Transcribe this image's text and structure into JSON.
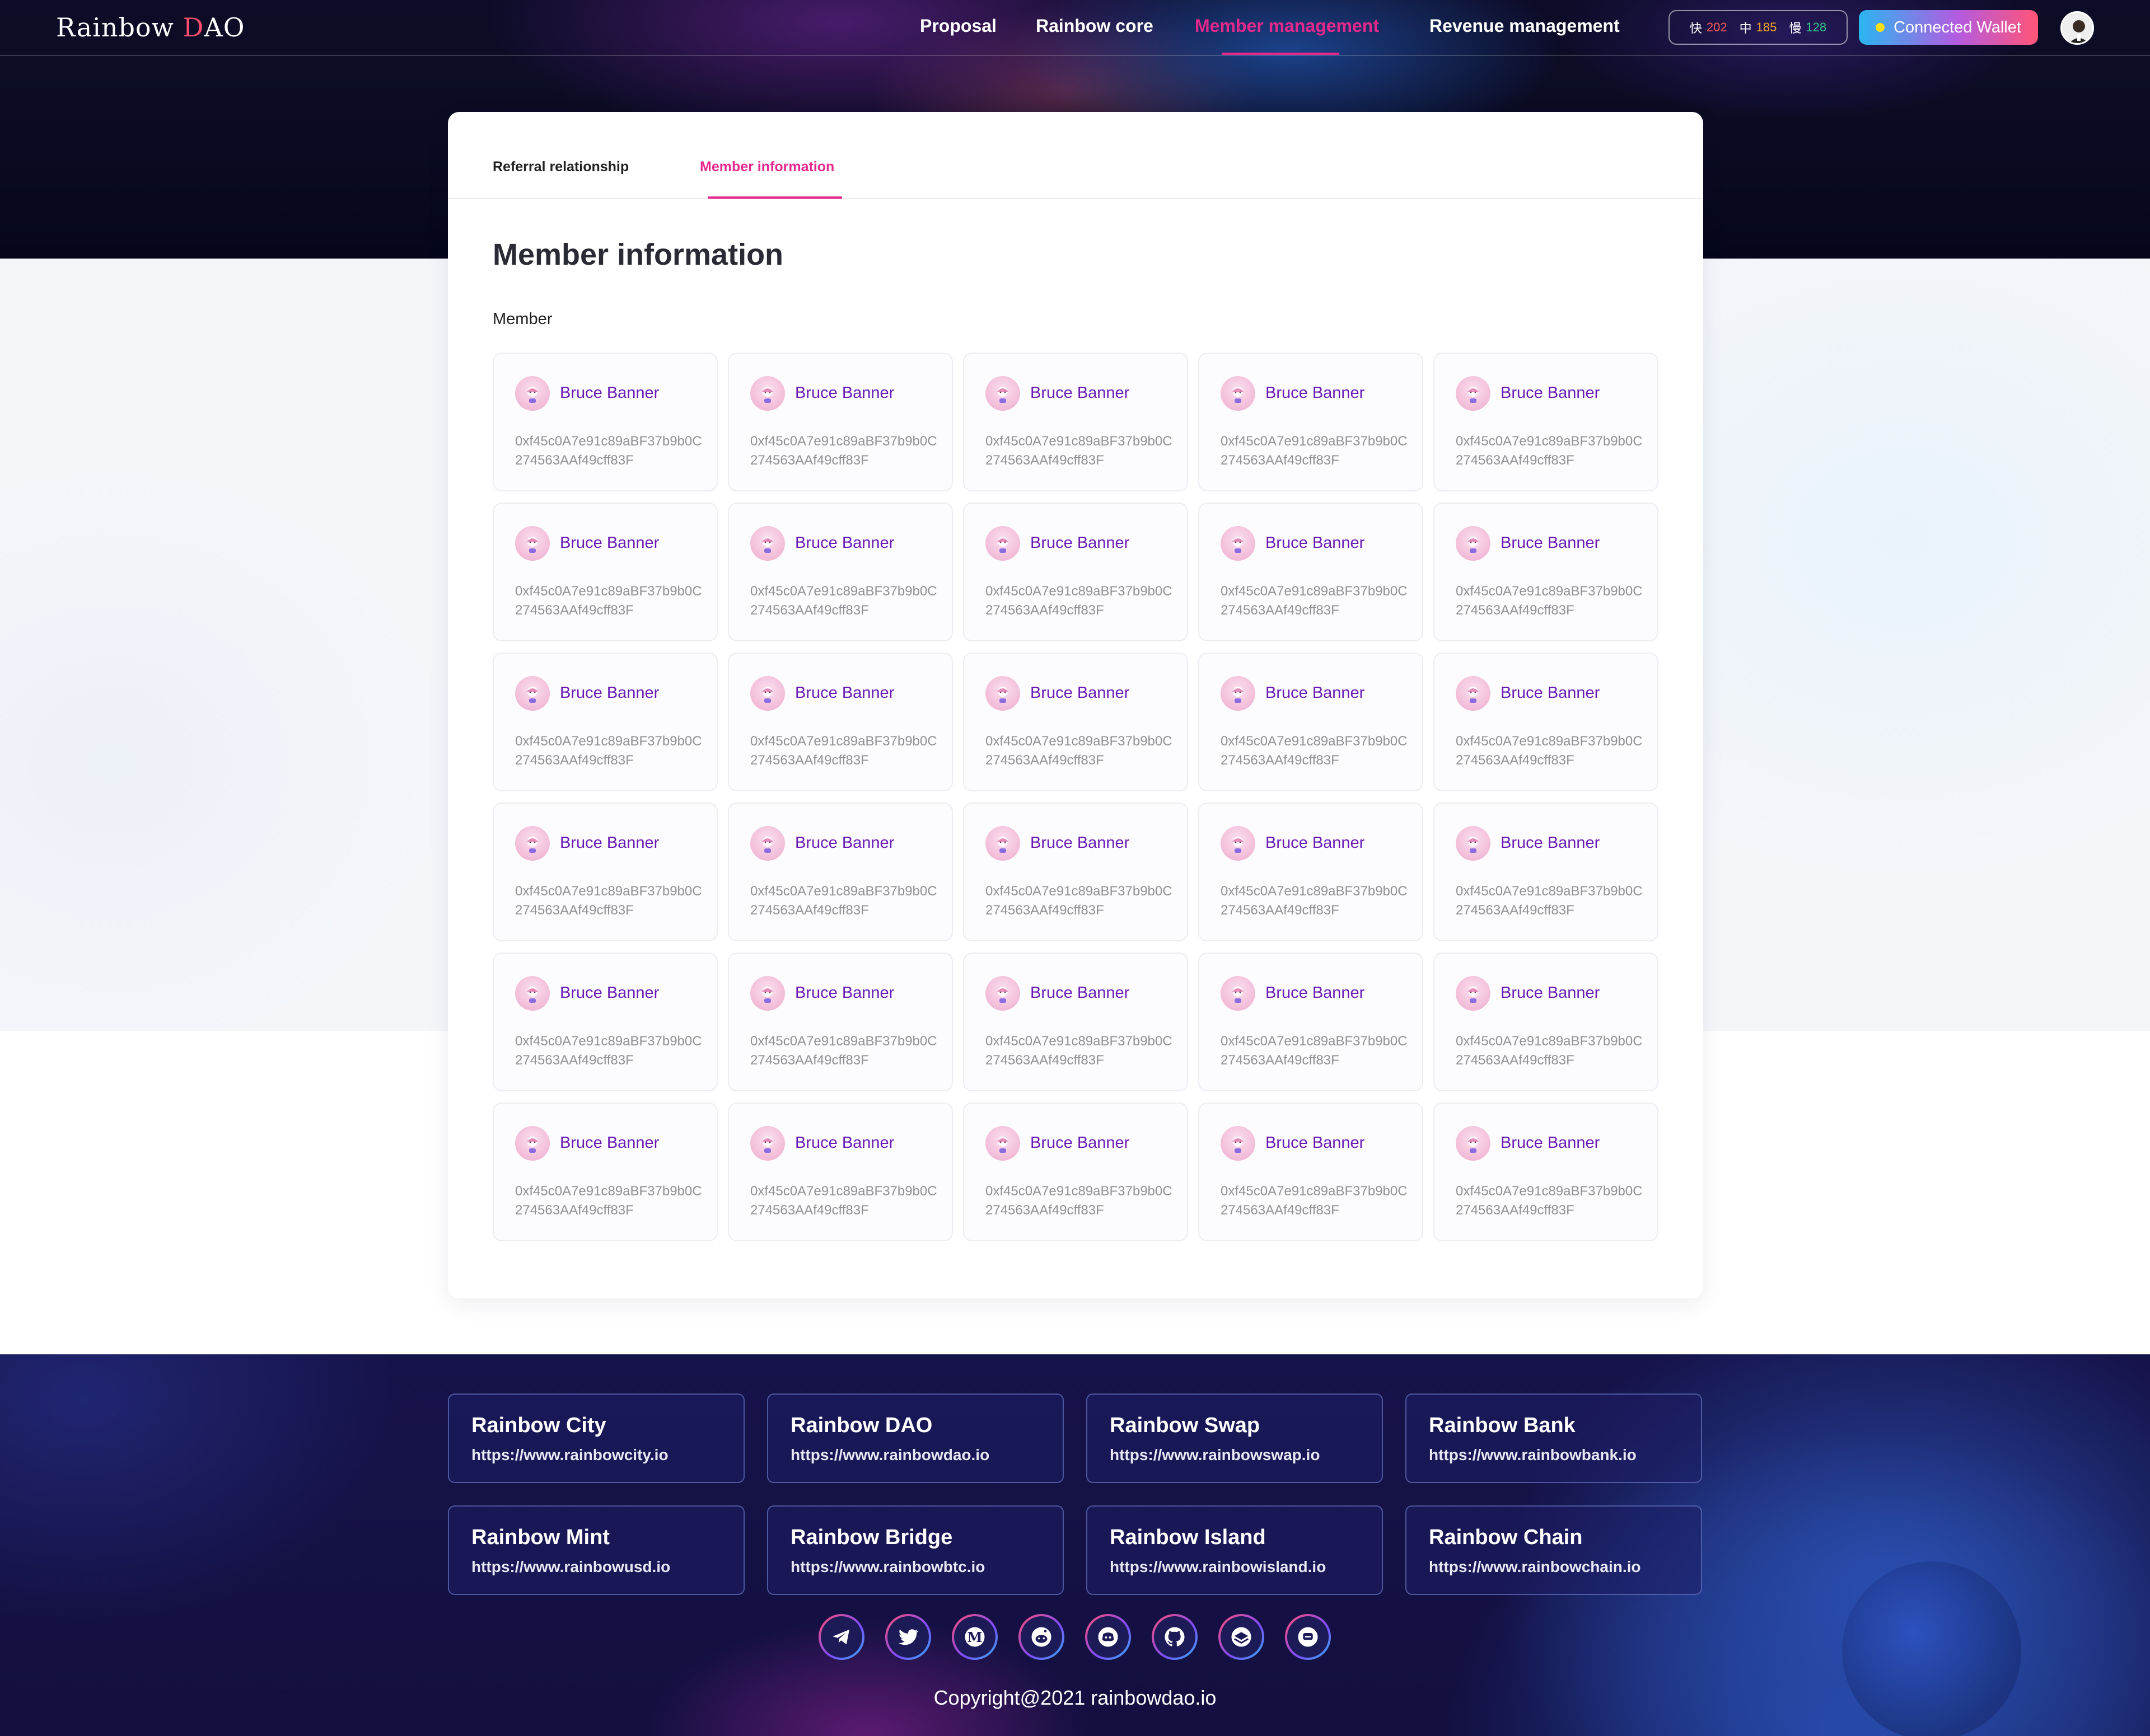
{
  "brand": {
    "logo_main": "Rainbow ",
    "logo_d": "D",
    "logo_rest": "AO"
  },
  "nav": {
    "links": [
      "Proposal",
      "Rainbow core",
      "Member management",
      "Revenue management"
    ],
    "active_index": 2,
    "gas": [
      {
        "label": "快",
        "value": "202"
      },
      {
        "label": "中",
        "value": "185"
      },
      {
        "label": "慢",
        "value": "128"
      }
    ],
    "wallet_label": "Connected Wallet"
  },
  "tabs": [
    "Referral relationship",
    "Member information"
  ],
  "active_tab": 1,
  "section_title": "Member information",
  "member_label": "Member",
  "members": [
    {
      "name": "Bruce Banner",
      "address": "0xf45c0A7e91c89aBF37b9b0C274563AAf49cff83F"
    },
    {
      "name": "Bruce Banner",
      "address": "0xf45c0A7e91c89aBF37b9b0C274563AAf49cff83F"
    },
    {
      "name": "Bruce Banner",
      "address": "0xf45c0A7e91c89aBF37b9b0C274563AAf49cff83F"
    },
    {
      "name": "Bruce Banner",
      "address": "0xf45c0A7e91c89aBF37b9b0C274563AAf49cff83F"
    },
    {
      "name": "Bruce Banner",
      "address": "0xf45c0A7e91c89aBF37b9b0C274563AAf49cff83F"
    },
    {
      "name": "Bruce Banner",
      "address": "0xf45c0A7e91c89aBF37b9b0C274563AAf49cff83F"
    },
    {
      "name": "Bruce Banner",
      "address": "0xf45c0A7e91c89aBF37b9b0C274563AAf49cff83F"
    },
    {
      "name": "Bruce Banner",
      "address": "0xf45c0A7e91c89aBF37b9b0C274563AAf49cff83F"
    },
    {
      "name": "Bruce Banner",
      "address": "0xf45c0A7e91c89aBF37b9b0C274563AAf49cff83F"
    },
    {
      "name": "Bruce Banner",
      "address": "0xf45c0A7e91c89aBF37b9b0C274563AAf49cff83F"
    },
    {
      "name": "Bruce Banner",
      "address": "0xf45c0A7e91c89aBF37b9b0C274563AAf49cff83F"
    },
    {
      "name": "Bruce Banner",
      "address": "0xf45c0A7e91c89aBF37b9b0C274563AAf49cff83F"
    },
    {
      "name": "Bruce Banner",
      "address": "0xf45c0A7e91c89aBF37b9b0C274563AAf49cff83F"
    },
    {
      "name": "Bruce Banner",
      "address": "0xf45c0A7e91c89aBF37b9b0C274563AAf49cff83F"
    },
    {
      "name": "Bruce Banner",
      "address": "0xf45c0A7e91c89aBF37b9b0C274563AAf49cff83F"
    },
    {
      "name": "Bruce Banner",
      "address": "0xf45c0A7e91c89aBF37b9b0C274563AAf49cff83F"
    },
    {
      "name": "Bruce Banner",
      "address": "0xf45c0A7e91c89aBF37b9b0C274563AAf49cff83F"
    },
    {
      "name": "Bruce Banner",
      "address": "0xf45c0A7e91c89aBF37b9b0C274563AAf49cff83F"
    },
    {
      "name": "Bruce Banner",
      "address": "0xf45c0A7e91c89aBF37b9b0C274563AAf49cff83F"
    },
    {
      "name": "Bruce Banner",
      "address": "0xf45c0A7e91c89aBF37b9b0C274563AAf49cff83F"
    },
    {
      "name": "Bruce Banner",
      "address": "0xf45c0A7e91c89aBF37b9b0C274563AAf49cff83F"
    },
    {
      "name": "Bruce Banner",
      "address": "0xf45c0A7e91c89aBF37b9b0C274563AAf49cff83F"
    },
    {
      "name": "Bruce Banner",
      "address": "0xf45c0A7e91c89aBF37b9b0C274563AAf49cff83F"
    },
    {
      "name": "Bruce Banner",
      "address": "0xf45c0A7e91c89aBF37b9b0C274563AAf49cff83F"
    },
    {
      "name": "Bruce Banner",
      "address": "0xf45c0A7e91c89aBF37b9b0C274563AAf49cff83F"
    },
    {
      "name": "Bruce Banner",
      "address": "0xf45c0A7e91c89aBF37b9b0C274563AAf49cff83F"
    },
    {
      "name": "Bruce Banner",
      "address": "0xf45c0A7e91c89aBF37b9b0C274563AAf49cff83F"
    },
    {
      "name": "Bruce Banner",
      "address": "0xf45c0A7e91c89aBF37b9b0C274563AAf49cff83F"
    },
    {
      "name": "Bruce Banner",
      "address": "0xf45c0A7e91c89aBF37b9b0C274563AAf49cff83F"
    },
    {
      "name": "Bruce Banner",
      "address": "0xf45c0A7e91c89aBF37b9b0C274563AAf49cff83F"
    }
  ],
  "footer": {
    "links": [
      {
        "title": "Rainbow City",
        "url": "https://www.rainbowcity.io"
      },
      {
        "title": "Rainbow DAO",
        "url": "https://www.rainbowdao.io"
      },
      {
        "title": "Rainbow Swap",
        "url": "https://www.rainbowswap.io"
      },
      {
        "title": "Rainbow Bank",
        "url": "https://www.rainbowbank.io"
      },
      {
        "title": "Rainbow Mint",
        "url": "https://www.rainbowusd.io"
      },
      {
        "title": "Rainbow Bridge",
        "url": "https://www.rainbowbtc.io"
      },
      {
        "title": "Rainbow Island",
        "url": "https://www.rainbowisland.io"
      },
      {
        "title": "Rainbow Chain",
        "url": "https://www.rainbowchain.io"
      }
    ],
    "socials": [
      "telegram-icon",
      "twitter-icon",
      "medium-icon",
      "reddit-icon",
      "discord-icon",
      "github-icon",
      "gitbook-icon",
      "chat-icon"
    ],
    "copyright": "Copyright@2021 rainbowdao.io"
  },
  "colors": {
    "accent": "#e5288c",
    "name_purple": "#6a1cb5",
    "footer_bg": "#16134a"
  }
}
